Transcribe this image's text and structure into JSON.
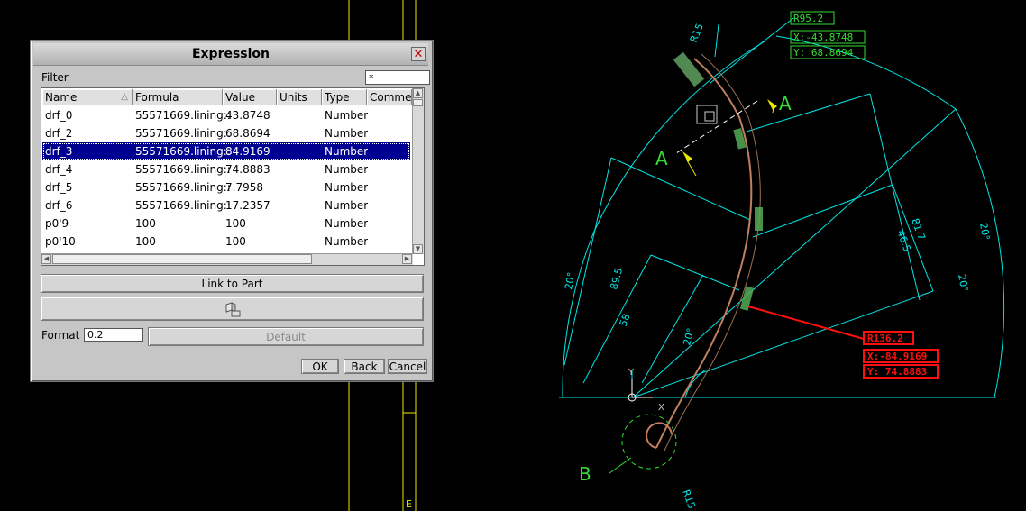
{
  "dialog": {
    "title": "Expression",
    "filter_label": "Filter",
    "filter_value": "*",
    "columns": [
      "Name",
      "Formula",
      "Value",
      "Units",
      "Type",
      "Commer"
    ],
    "rows": [
      {
        "name": "drf_0",
        "formula": "55571669.lining::",
        "value": "43.8748",
        "units": "",
        "type": "Number",
        "selected": false
      },
      {
        "name": "drf_2",
        "formula": "55571669.lining::",
        "value": "68.8694",
        "units": "",
        "type": "Number",
        "selected": false
      },
      {
        "name": "drf_3",
        "formula": "55571669.lining::",
        "value": "84.9169",
        "units": "",
        "type": "Number",
        "selected": true
      },
      {
        "name": "drf_4",
        "formula": "55571669.lining::",
        "value": "74.8883",
        "units": "",
        "type": "Number",
        "selected": false
      },
      {
        "name": "drf_5",
        "formula": "55571669.lining::",
        "value": "7.7958",
        "units": "",
        "type": "Number",
        "selected": false
      },
      {
        "name": "drf_6",
        "formula": "55571669.lining::",
        "value": "17.2357",
        "units": "",
        "type": "Number",
        "selected": false
      },
      {
        "name": "p0'9",
        "formula": "100",
        "value": "100",
        "units": "",
        "type": "Number",
        "selected": false
      },
      {
        "name": "p0'10",
        "formula": "100",
        "value": "100",
        "units": "",
        "type": "Number",
        "selected": false
      }
    ],
    "link_button": "Link to Part",
    "format_label": "Format",
    "format_value": "0.2",
    "default_button": "Default",
    "ok_button": "OK",
    "back_button": "Back",
    "cancel_button": "Cancel"
  },
  "cad": {
    "left_ruler_letter": "E",
    "green_box": [
      "R95.2",
      "X:-43.8748",
      "Y: 68.8694"
    ],
    "red_box": [
      "R136.2",
      "X:-84.9169",
      "Y: 74.8883"
    ],
    "section_marks": [
      "A",
      "A"
    ],
    "detail_mark": "B",
    "dims": [
      "R15",
      "R15",
      "20°",
      "20°",
      "20°",
      "20°",
      "89.5",
      "58",
      "46.5",
      "81.7"
    ],
    "axis_labels": [
      "Y",
      "X"
    ]
  },
  "colors": {
    "cyan": "#00e6e6",
    "green": "#33dd33",
    "red": "#ff1010",
    "yellow": "#e8e800",
    "selection": "#000090"
  }
}
